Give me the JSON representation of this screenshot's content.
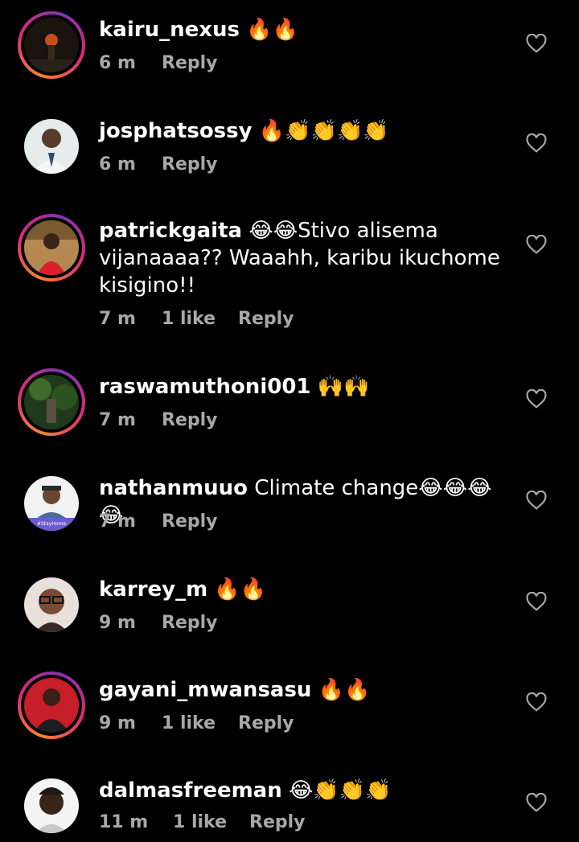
{
  "comments": [
    {
      "username": "kairu_nexus",
      "text": "",
      "emoji": "🔥🔥",
      "time": "6 m",
      "likes": "",
      "reply": "Reply"
    },
    {
      "username": "josphatsossy",
      "text": "",
      "emoji": "🔥👏👏👏👏",
      "time": "6 m",
      "likes": "",
      "reply": "Reply"
    },
    {
      "username": "patrickgaita",
      "text": "Stivo alisema vijanaaaa?? Waaahh, karibu ikuchome kisigino!!",
      "emoji": "😂😂",
      "time": "7 m",
      "likes": "1 like",
      "reply": "Reply"
    },
    {
      "username": "raswamuthoni001",
      "text": "",
      "emoji": "🙌🙌",
      "time": "7 m",
      "likes": "",
      "reply": "Reply"
    },
    {
      "username": "nathanmuuo",
      "text": "Climate change",
      "emoji": "😂😂😂😂",
      "time": "7 m",
      "likes": "",
      "reply": "Reply"
    },
    {
      "username": "karrey_m",
      "text": "",
      "emoji": "🔥🔥",
      "time": "9 m",
      "likes": "",
      "reply": "Reply"
    },
    {
      "username": "gayani_mwansasu",
      "text": "",
      "emoji": "🔥🔥",
      "time": "9 m",
      "likes": "1 like",
      "reply": "Reply"
    },
    {
      "username": "dalmasfreeman",
      "text": "",
      "emoji": "😂👏👏👏",
      "time": "11 m",
      "likes": "1 like",
      "reply": "Reply"
    }
  ],
  "avatar_badge_text": "#StayHome",
  "icons": {
    "like": "heart-outline-icon"
  }
}
